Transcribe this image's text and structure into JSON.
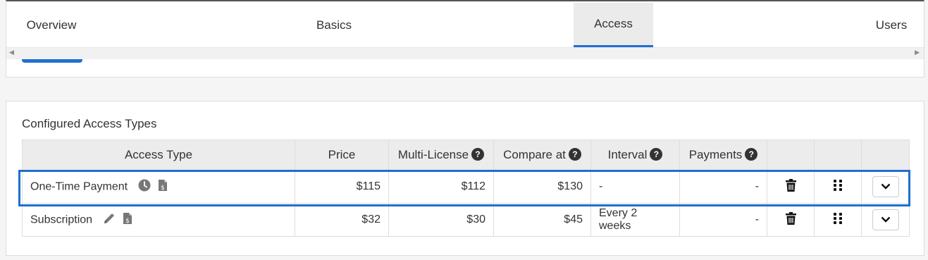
{
  "tabs": [
    {
      "label": "Overview"
    },
    {
      "label": "Basics"
    },
    {
      "label": "Access",
      "active": true
    },
    {
      "label": "Users"
    }
  ],
  "section": {
    "title": "Configured Access Types"
  },
  "table": {
    "headers": [
      "Access Type",
      "Price",
      "Multi-License",
      "Compare at",
      "Interval",
      "Payments"
    ],
    "rows": [
      {
        "name": "One-Time Payment",
        "type_icon": "clock-icon",
        "doc_icon": "invoice-dollar-icon",
        "price": "$115",
        "multi_license": "$112",
        "compare_at": "$130",
        "interval": "-",
        "payments": "-",
        "selected": true
      },
      {
        "name": "Subscription",
        "type_icon": "pencil-icon",
        "doc_icon": "invoice-dollar-icon",
        "price": "$32",
        "multi_license": "$30",
        "compare_at": "$45",
        "interval": "Every 2 weeks",
        "payments": "-"
      }
    ]
  },
  "colors": {
    "accent": "#1f6fd1"
  }
}
